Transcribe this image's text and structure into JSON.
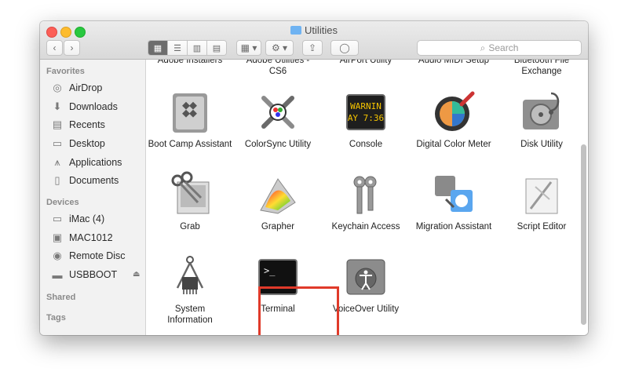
{
  "window": {
    "title": "Utilities"
  },
  "toolbar": {
    "back": "‹",
    "forward": "›",
    "view_modes": [
      "▦",
      "☰",
      "▥",
      "▤"
    ],
    "arrange": "▦ ▾",
    "action": "⚙ ▾",
    "share": "⇪",
    "tag": "◯"
  },
  "search": {
    "placeholder": "Search",
    "icon": "magnifier-icon"
  },
  "sidebar": {
    "favorites_title": "Favorites",
    "favorites": [
      {
        "label": "AirDrop",
        "icon": "airdrop-icon"
      },
      {
        "label": "Downloads",
        "icon": "downloads-icon"
      },
      {
        "label": "Recents",
        "icon": "recents-icon"
      },
      {
        "label": "Desktop",
        "icon": "desktop-icon"
      },
      {
        "label": "Applications",
        "icon": "applications-icon"
      },
      {
        "label": "Documents",
        "icon": "documents-icon"
      }
    ],
    "devices_title": "Devices",
    "devices": [
      {
        "label": "iMac (4)",
        "icon": "imac-icon"
      },
      {
        "label": "MAC1012",
        "icon": "disk-icon"
      },
      {
        "label": "Remote Disc",
        "icon": "remote-disc-icon"
      },
      {
        "label": "USBBOOT",
        "icon": "usb-drive-icon"
      }
    ],
    "eject": "⏏",
    "shared_title": "Shared",
    "tags_title": "Tags"
  },
  "cut_row": [
    "Adobe Installers",
    "Adobe Utilities -",
    "AirPort Utility",
    "Audio MIDI Setup",
    "Bluetooth File"
  ],
  "cut_row_line2": [
    "",
    "CS6",
    "",
    "",
    "Exchange"
  ],
  "apps": [
    {
      "label": "Boot Camp Assistant",
      "icon": "boot-camp-icon"
    },
    {
      "label": "ColorSync Utility",
      "icon": "colorsync-icon"
    },
    {
      "label": "Console",
      "icon": "console-icon",
      "screen_text": "WARNIN\nAY 7:36"
    },
    {
      "label": "Digital Color Meter",
      "icon": "color-meter-icon"
    },
    {
      "label": "Disk Utility",
      "icon": "disk-utility-icon"
    },
    {
      "label": "Grab",
      "icon": "grab-icon"
    },
    {
      "label": "Grapher",
      "icon": "grapher-icon"
    },
    {
      "label": "Keychain Access",
      "icon": "keychain-icon"
    },
    {
      "label": "Migration Assistant",
      "icon": "migration-icon"
    },
    {
      "label": "Script Editor",
      "icon": "script-editor-icon"
    },
    {
      "label": "System Information",
      "icon": "system-information-icon"
    },
    {
      "label": "Terminal",
      "icon": "terminal-icon",
      "screen_text": ">_"
    },
    {
      "label": "VoiceOver Utility",
      "icon": "voiceover-icon"
    }
  ],
  "colors": {
    "highlight": "#e03a2a",
    "active_view": "#6d6d6d"
  }
}
